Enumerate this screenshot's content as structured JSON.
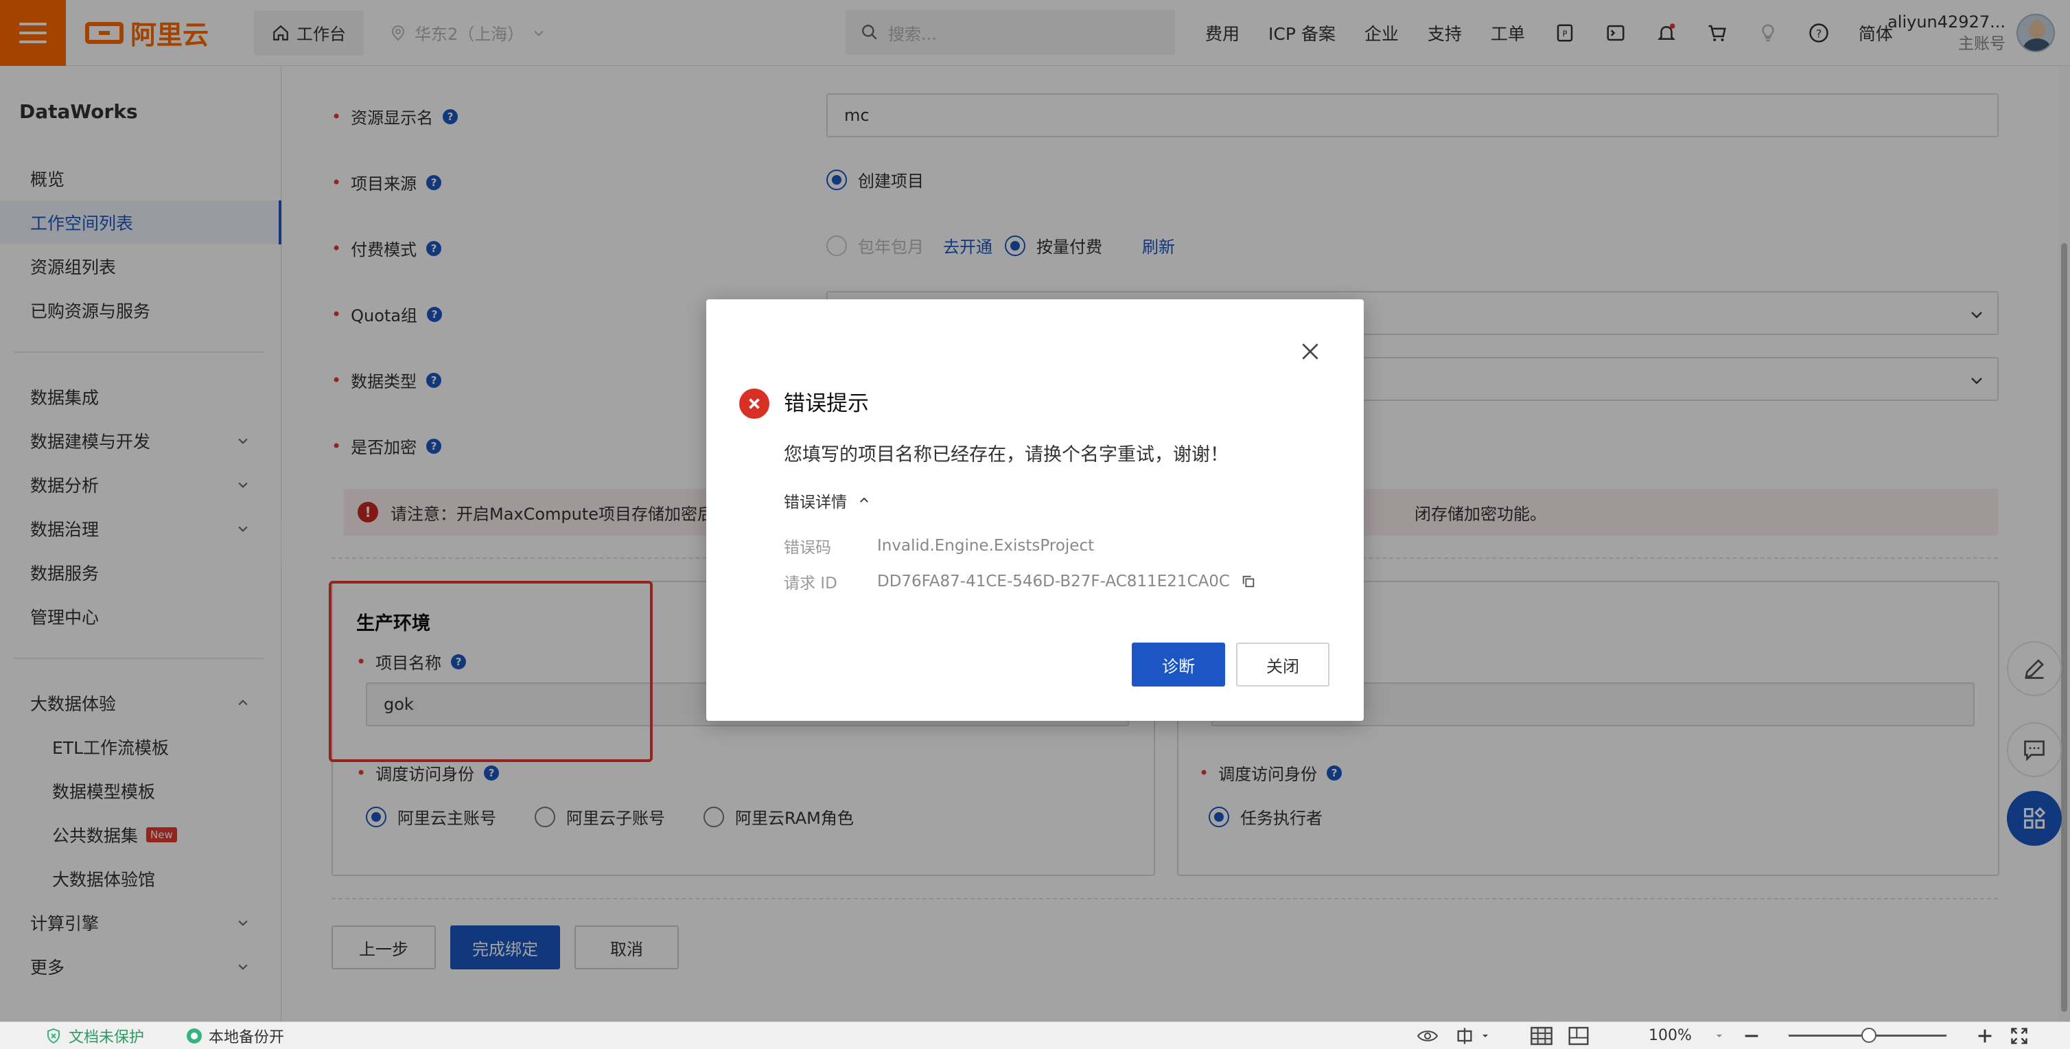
{
  "topbar": {
    "logo_text": "阿里云",
    "workbench": "工作台",
    "region": "华东2（上海）",
    "search_placeholder": "搜索...",
    "nav": [
      "费用",
      "ICP 备案",
      "企业",
      "支持",
      "工单"
    ],
    "language": "简体",
    "user_name": "aliyun42927...",
    "user_role": "主账号"
  },
  "sidebar": {
    "title": "DataWorks",
    "group1": [
      "概览",
      "工作空间列表",
      "资源组列表",
      "已购资源与服务"
    ],
    "group2": [
      "数据集成",
      "数据建模与开发",
      "数据分析",
      "数据治理",
      "数据服务",
      "管理中心"
    ],
    "experience": {
      "label": "大数据体验",
      "items": [
        "ETL工作流模板",
        "数据模型模板",
        "公共数据集",
        "大数据体验馆"
      ],
      "new_badge": "New"
    },
    "group4": [
      "计算引擎",
      "更多"
    ]
  },
  "form": {
    "display_name_label": "资源显示名",
    "display_name_value": "mc",
    "project_source_label": "项目来源",
    "project_source_option": "创建项目",
    "billing_label": "付费模式",
    "billing_sub": "包年包月",
    "billing_activate": "去开通",
    "billing_payg": "按量付费",
    "billing_refresh": "刷新",
    "quota_label": "Quota组",
    "data_type_label": "数据类型",
    "encrypt_label": "是否加密",
    "notice_left": "请注意：开启MaxCompute项目存储加密后",
    "notice_right": "闭存储加密功能。",
    "prod_env_title": "生产环境",
    "project_name_label": "项目名称",
    "project_name_value": "gok",
    "schedule_identity_label": "调度访问身份",
    "identity_options": [
      "阿里云主账号",
      "阿里云子账号",
      "阿里云RAM角色"
    ],
    "right_schedule_identity_label": "调度访问身份",
    "right_identity_option": "任务执行者",
    "buttons": {
      "prev": "上一步",
      "finish": "完成绑定",
      "cancel": "取消"
    }
  },
  "dialog": {
    "title": "错误提示",
    "message": "您填写的项目名称已经存在，请换个名字重试，谢谢！",
    "detail_toggle": "错误详情",
    "error_code_label": "错误码",
    "error_code_value": "Invalid.Engine.ExistsProject",
    "request_id_label": "请求 ID",
    "request_id_value": "DD76FA87-41CE-546D-B27F-AC811E21CA0C",
    "diagnose_button": "诊断",
    "close_button": "关闭"
  },
  "statusbar": {
    "doc_protect": "文档未保护",
    "backup": "本地备份开",
    "zoom": "100%"
  },
  "colors": {
    "brand": "#ff6a00",
    "primary": "#1c56c4",
    "error": "#d93026"
  }
}
